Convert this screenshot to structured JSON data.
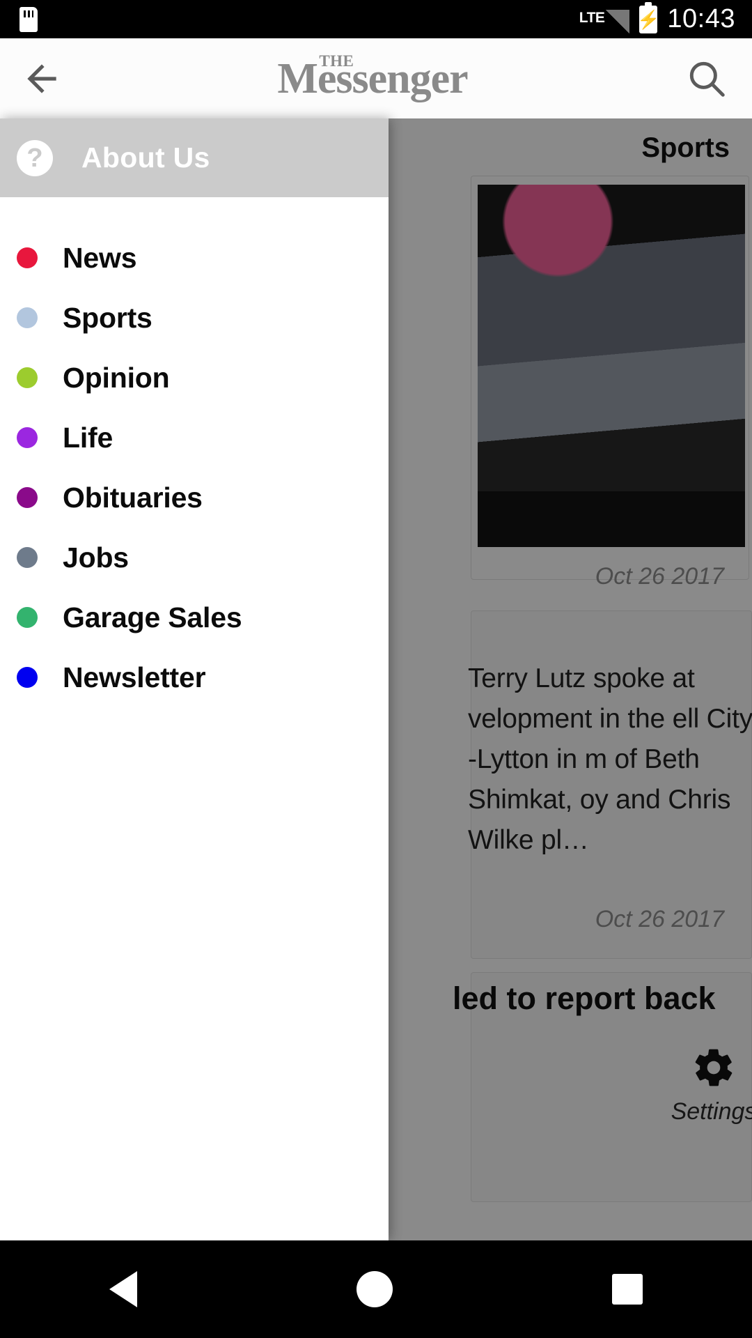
{
  "status_bar": {
    "sdcard_icon": "sd-card-icon",
    "network_label": "LTE",
    "signal_icon": "signal-bars-icon",
    "battery_icon": "battery-charging-icon",
    "battery_bolt": "⚡",
    "time": "10:43"
  },
  "app_bar": {
    "back_icon": "back-arrow-icon",
    "brand_prefix": "THE",
    "brand_name": "Messenger",
    "search_icon": "search-icon"
  },
  "drawer": {
    "header": {
      "icon": "help-circle-icon",
      "icon_glyph": "?",
      "label": "About Us",
      "background_color": "#cbcbcb"
    },
    "items": [
      {
        "label": "News",
        "color": "#e8173d",
        "icon": "color-dot-icon"
      },
      {
        "label": "Sports",
        "color": "#b2c6de",
        "icon": "color-dot-icon"
      },
      {
        "label": "Opinion",
        "color": "#9ccc2e",
        "icon": "color-dot-icon"
      },
      {
        "label": "Life",
        "color": "#9b27e0",
        "icon": "color-dot-icon"
      },
      {
        "label": "Obituaries",
        "color": "#8a0a8a",
        "icon": "color-dot-icon"
      },
      {
        "label": "Jobs",
        "color": "#6e7b8b",
        "icon": "color-dot-icon"
      },
      {
        "label": "Garage Sales",
        "color": "#33b36e",
        "icon": "color-dot-icon"
      },
      {
        "label": "Newsletter",
        "color": "#0000f0",
        "icon": "color-dot-icon"
      }
    ]
  },
  "background_content": {
    "section_title": "Sports",
    "article_1": {
      "date": "Oct 26 2017",
      "photo": "article-photo"
    },
    "article_2": {
      "body": "Terry Lutz spoke at velopment in the ell City -Lytton in m of Beth Shimkat, oy and Chris Wilke pl…",
      "date": "Oct 26 2017"
    },
    "article_3": {
      "headline": "led to report back"
    },
    "settings": {
      "icon": "gear-icon",
      "label": "Settings"
    }
  },
  "nav_bar": {
    "back_icon": "nav-back-triangle-icon",
    "home_icon": "nav-home-circle-icon",
    "recents_icon": "nav-recents-square-icon"
  }
}
